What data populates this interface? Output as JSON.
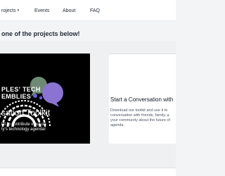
{
  "nav": {
    "projects_label": "rojects",
    "projects_caret": "▾",
    "events_label": "Events",
    "about_label": "About",
    "faq_label": "FAQ"
  },
  "headline": "one of the projects below!",
  "project_card": {
    "org_line_1": "PLES' TECH",
    "org_line_2": "EMBLIES",
    "title": "sation Toolkit",
    "subtitle_line_1": "kit to contribute input on",
    "subtitle_line_2": "ty's technology agenda!",
    "colors": {
      "background": "#000000",
      "bubble_green": "#6f8a74",
      "bubble_purple": "#8b73d1",
      "bubble_teal": "#4f7d7a",
      "dot": "#6b5fd6"
    }
  },
  "card_text": {
    "title": "Start a Conversation with",
    "desc_line_1": "Download our toolkit and use it to",
    "desc_line_2": "conversation with friends, family, a",
    "desc_line_3": "your community about the future of",
    "desc_line_4": "agenda."
  }
}
